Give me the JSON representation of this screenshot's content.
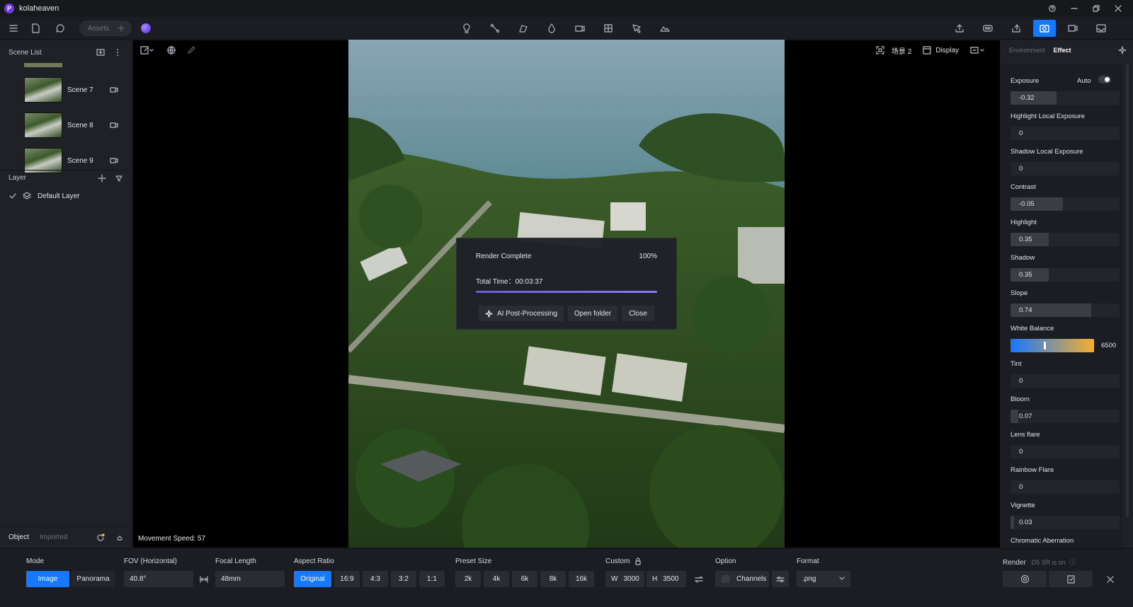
{
  "app": {
    "title": "kolaheaven",
    "logo_letter": "P"
  },
  "toolbar": {
    "assets_label": "Assets"
  },
  "scene_list": {
    "title": "Scene List",
    "scenes": [
      {
        "label": "Scene 7"
      },
      {
        "label": "Scene 8"
      },
      {
        "label": "Scene 9"
      }
    ]
  },
  "layer": {
    "title": "Layer",
    "default_layer": "Default Layer"
  },
  "object_bar": {
    "object_tab": "Object",
    "imported_tab": "Imported"
  },
  "viewport": {
    "scene_name": "场景 2",
    "display_label": "Display",
    "movement_speed": "Movement Speed: 57"
  },
  "render_dialog": {
    "title": "Render Complete",
    "percent": "100%",
    "progress": 1.0,
    "total_time": "Total Time：00:03:37",
    "ai_button": "AI Post-Processing",
    "open_folder_button": "Open folder",
    "close_button": "Close"
  },
  "right_panel": {
    "tab_environment": "Environment",
    "tab_effect": "Effect",
    "auto_label": "Auto",
    "properties": [
      {
        "label": "Exposure",
        "value": "-0.32",
        "fill": 0.42
      },
      {
        "label": "Highlight Local Exposure",
        "value": "0",
        "fill": 0
      },
      {
        "label": "Shadow Local Exposure",
        "value": "0",
        "fill": 0
      },
      {
        "label": "Contrast",
        "value": "-0.05",
        "fill": 0.48
      },
      {
        "label": "Highlight",
        "value": "0.35",
        "fill": 0.35
      },
      {
        "label": "Shadow",
        "value": "0.35",
        "fill": 0.35
      },
      {
        "label": "Slope",
        "value": "0.74",
        "fill": 0.74
      },
      {
        "label": "White Balance",
        "value": "6500",
        "fill": 0.4
      },
      {
        "label": "Tint",
        "value": "0",
        "fill": 0
      },
      {
        "label": "Bloom",
        "value": "0.07",
        "fill": 0.07
      },
      {
        "label": "Lens flare",
        "value": "0",
        "fill": 0
      },
      {
        "label": "Rainbow Flare",
        "value": "0",
        "fill": 0
      },
      {
        "label": "Vignette",
        "value": "0.03",
        "fill": 0.03
      },
      {
        "label": "Chromatic Aberration",
        "value": "",
        "fill": 0
      }
    ]
  },
  "bottom": {
    "mode_label": "Mode",
    "mode_image": "Image",
    "mode_panorama": "Panorama",
    "fov_label": "FOV (Horizontal)",
    "fov_value": "40.8°",
    "focal_label": "Focal Length",
    "focal_value": "48mm",
    "aspect_label": "Aspect Ratio",
    "aspect_options": [
      "Original",
      "16:9",
      "4:3",
      "3:2",
      "1:1"
    ],
    "preset_label": "Preset Size",
    "preset_options": [
      "2k",
      "4k",
      "6k",
      "8k",
      "16k"
    ],
    "custom_label": "Custom",
    "width_prefix": "W",
    "width_value": "3000",
    "height_prefix": "H",
    "height_value": "3500",
    "option_label": "Option",
    "channels_label": "Channels",
    "format_label": "Format",
    "format_value": ".png",
    "render_label": "Render",
    "render_note": "D5 SR is on"
  },
  "colors": {
    "accent": "#1677ff",
    "progress": "#7b68ee"
  }
}
